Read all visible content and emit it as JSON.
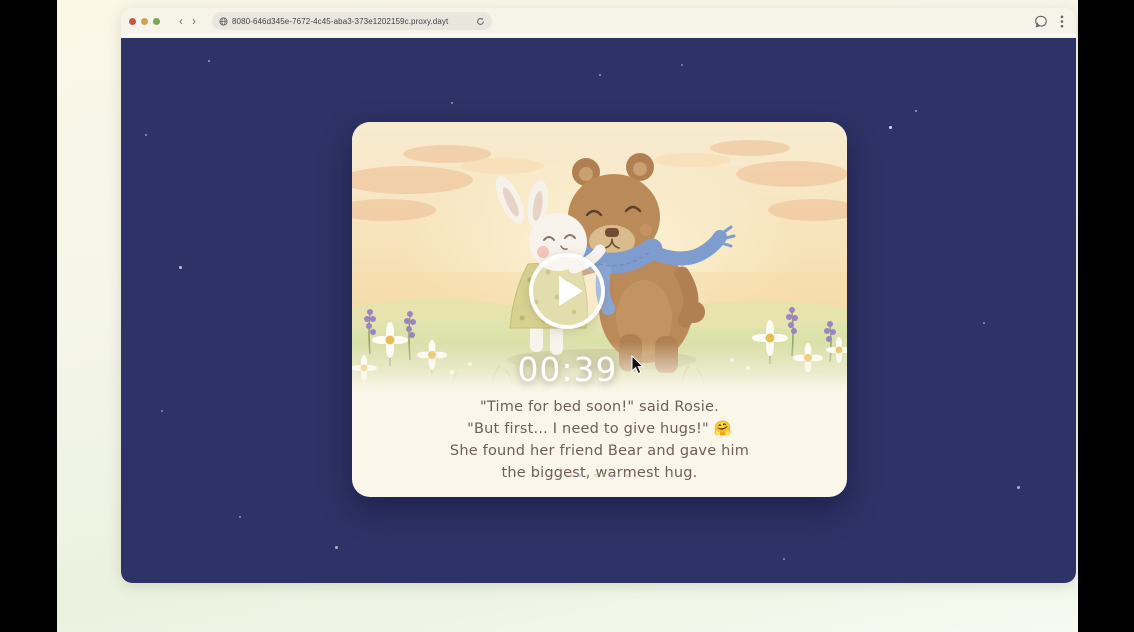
{
  "browser": {
    "url_text": "8080-646d345e-7672-4c45-aba3-373e1202159c.proxy.dayt",
    "back_glyph": "‹",
    "forward_glyph": "›",
    "icons": {
      "left": [
        "back-icon",
        "forward-icon"
      ],
      "url": [
        "globe-icon",
        "reload-icon"
      ],
      "right": [
        "chat-bubble-icon",
        "kebab-menu-icon"
      ]
    },
    "traffic_light_colors": [
      "#c9554c",
      "#cfa24e",
      "#7fa457"
    ]
  },
  "page": {
    "background_color": "#2e3367",
    "card_color": "#fbf6ea"
  },
  "player": {
    "timecode": "00:39",
    "play_icon": "play-triangle"
  },
  "story": {
    "lines": [
      "\"Time for bed soon!\" said Rosie.",
      "\"But first... I need to give hugs!\" 🤗",
      "She found her friend Bear and gave him",
      "the biggest, warmest hug."
    ],
    "text_color": "#6f6156"
  },
  "illustration": {
    "description": "watercolor bunny hugging bear in sunset meadow",
    "scarf_color": "#7f9ccf",
    "bear_color": "#ba8a58"
  }
}
